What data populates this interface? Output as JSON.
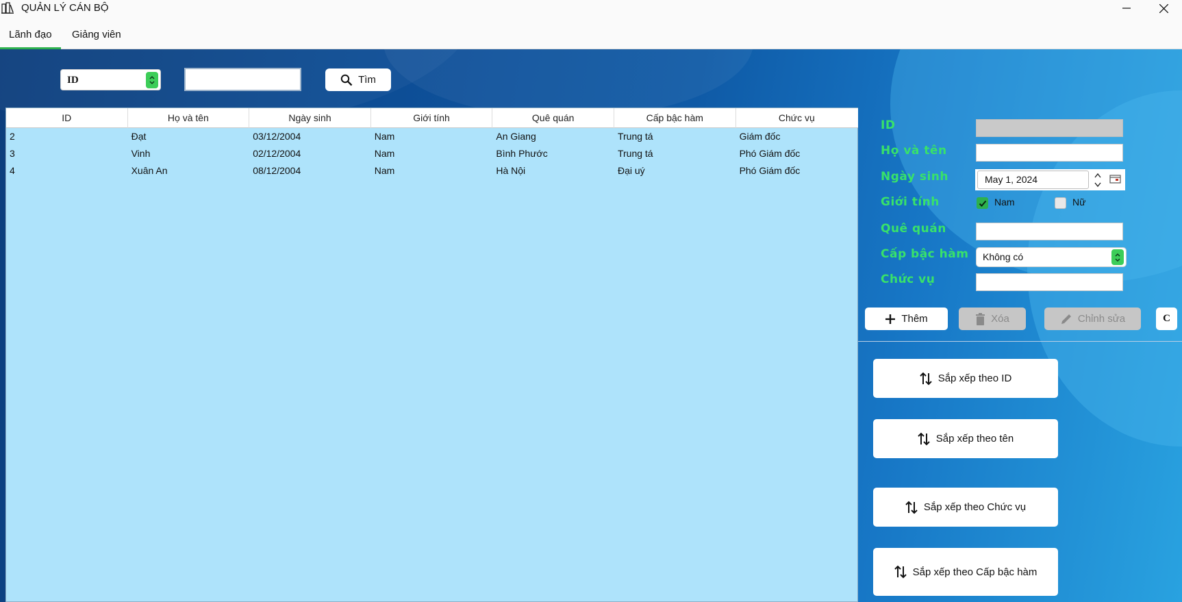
{
  "window": {
    "title": "QUẢN LÝ CÁN BỘ"
  },
  "tabs": [
    {
      "label": "Lãnh đạo"
    },
    {
      "label": "Giảng viên"
    }
  ],
  "search": {
    "field_selected": "ID",
    "query": "",
    "button_label": "Tìm"
  },
  "table": {
    "columns": [
      "ID",
      "Họ và tên",
      "Ngày sinh",
      "Giới tính",
      "Quê quán",
      "Cấp bậc hàm",
      "Chức vụ"
    ],
    "rows": [
      [
        "2",
        "Đạt",
        "03/12/2004",
        "Nam",
        "An Giang",
        "Trung tá",
        "Giám đốc"
      ],
      [
        "3",
        "Vinh",
        "02/12/2004",
        "Nam",
        "Bình Phước",
        "Trung tá",
        "Phó Giám đốc"
      ],
      [
        "4",
        "Xuân An",
        "08/12/2004",
        "Nam",
        "Hà Nội",
        "Đại uý",
        "Phó Giám đốc"
      ]
    ]
  },
  "form": {
    "labels": {
      "id": "ID",
      "name": "Họ và tên",
      "dob": "Ngày sinh",
      "gender": "Giới tính",
      "hometown": "Quê quán",
      "rank": "Cấp bậc hàm",
      "position": "Chức vụ"
    },
    "values": {
      "id": "",
      "name": "",
      "dob": "May 1, 2024",
      "hometown": "",
      "rank": "Không có",
      "position": ""
    },
    "gender_options": [
      {
        "label": "Nam",
        "checked": true
      },
      {
        "label": "Nữ",
        "checked": false
      }
    ]
  },
  "actions": {
    "add": "Thêm",
    "delete": "Xóa",
    "edit": "Chỉnh sửa",
    "clear": "C"
  },
  "sort_buttons": [
    "Sắp xếp theo ID",
    "Sắp xếp theo tên",
    "Sắp xếp theo Chức vụ",
    "Sắp xếp theo Cấp bậc hàm"
  ],
  "colors": {
    "accent_green": "#38e26a",
    "table_bg": "#aee3fb",
    "tab_underline": "#2db04d"
  }
}
